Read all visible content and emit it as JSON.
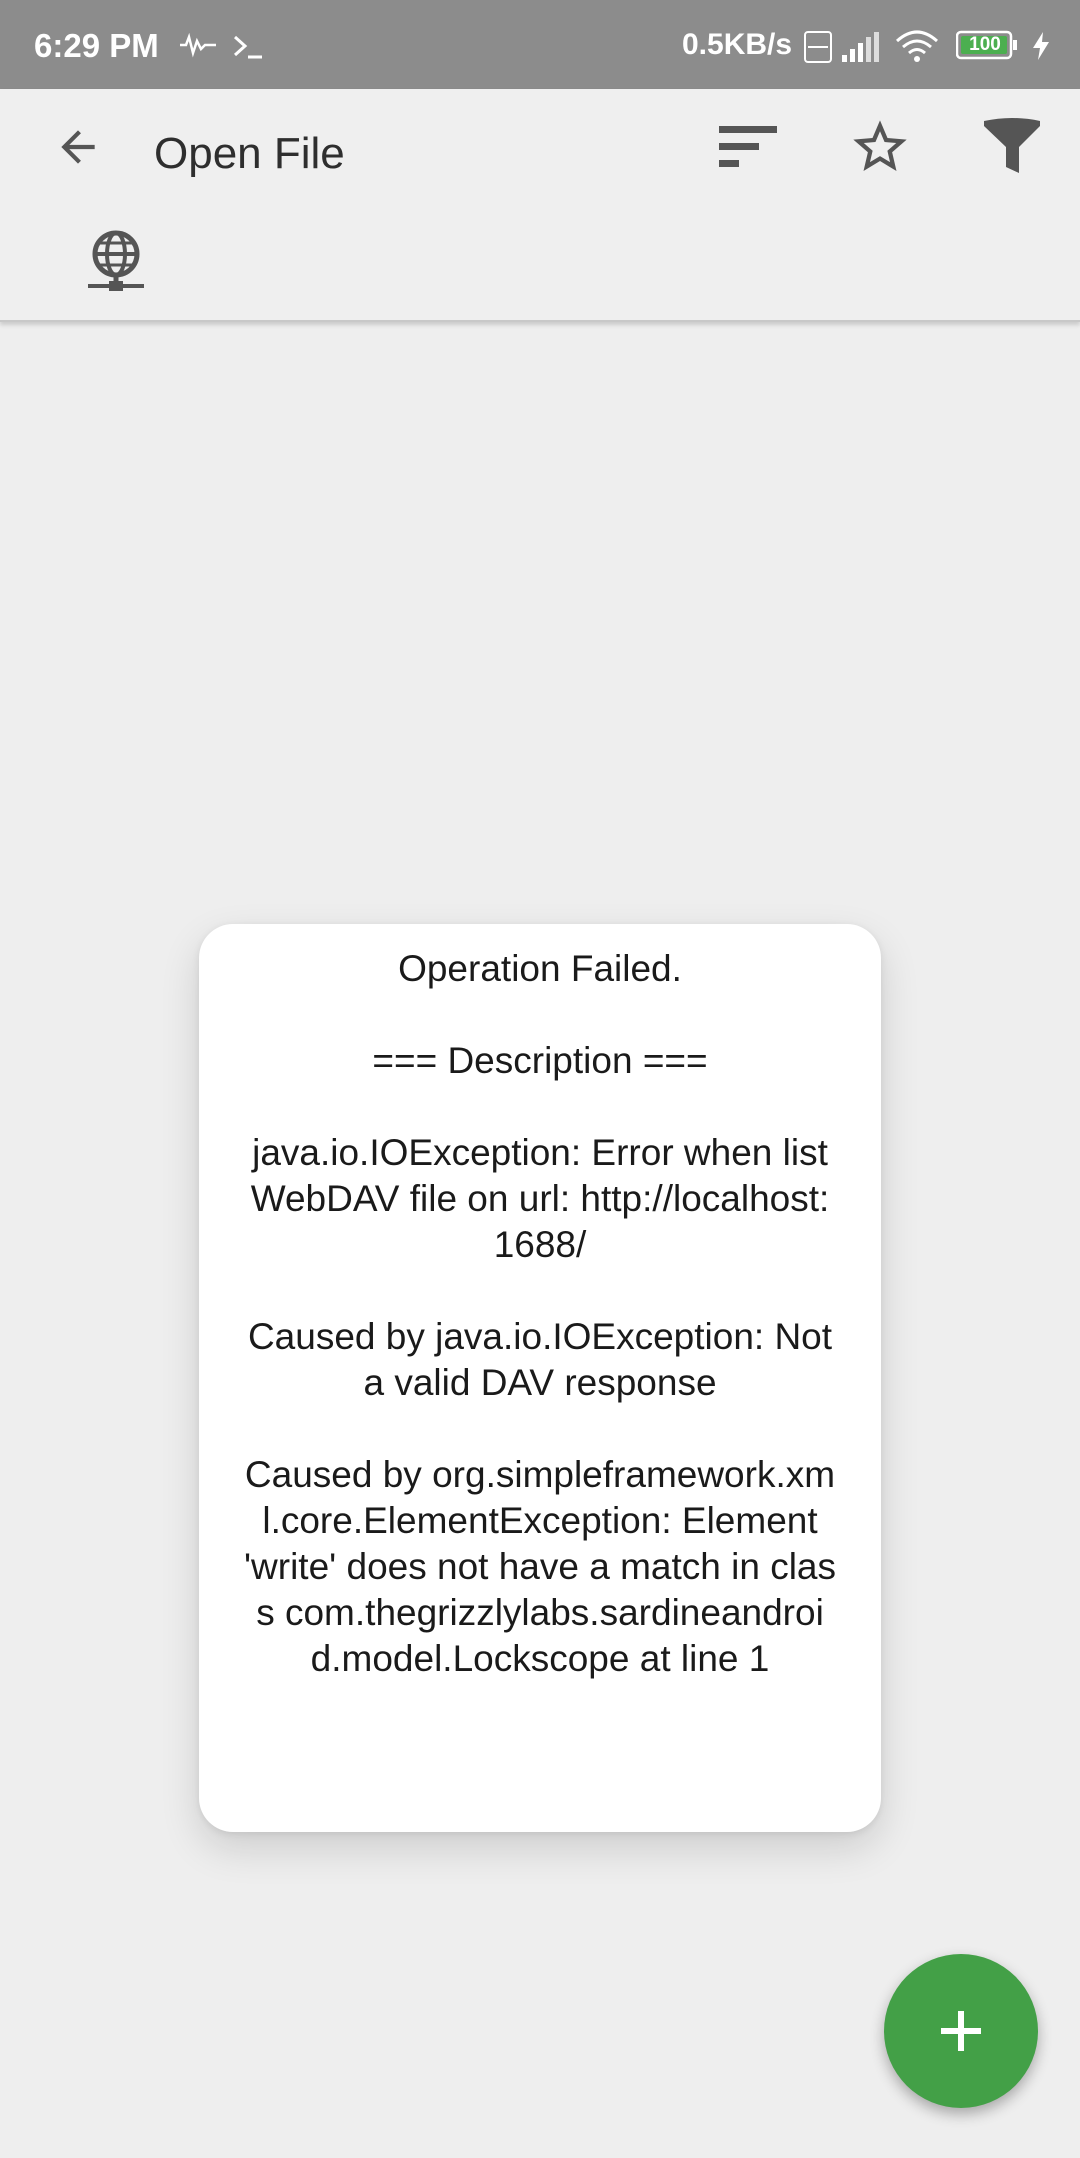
{
  "status_bar": {
    "time": "6:29 PM",
    "network_speed": "0.5KB/s",
    "battery_level": "100",
    "icons": [
      "activity-icon",
      "terminal-icon",
      "volte-icon",
      "signal-icon",
      "wifi-icon",
      "battery-icon",
      "charging-icon"
    ]
  },
  "app_bar": {
    "title": "Open File",
    "icons": [
      "back-arrow-icon",
      "sort-icon",
      "star-icon",
      "filter-icon",
      "network-globe-icon"
    ]
  },
  "dialog": {
    "heading": "Operation Failed.",
    "description_header": "=== Description ===",
    "message": "java.io.IOException: Error when list WebDAV file on url: http://localhost:1688/",
    "cause_1": "Caused by java.io.IOException: Not a valid DAV response",
    "cause_2": "Caused by org.simpleframework.xml.core.ElementException: Element 'write' does not have a match in class com.thegrizzlylabs.sardineandroid.model.Lockscope at line 1"
  },
  "fab": {
    "icon": "plus-icon"
  },
  "colors": {
    "status_bar": "#8c8c8c",
    "app_bar": "#efefef",
    "background": "#eeeeee",
    "fab": "#43a047",
    "battery": "#4caf50"
  }
}
